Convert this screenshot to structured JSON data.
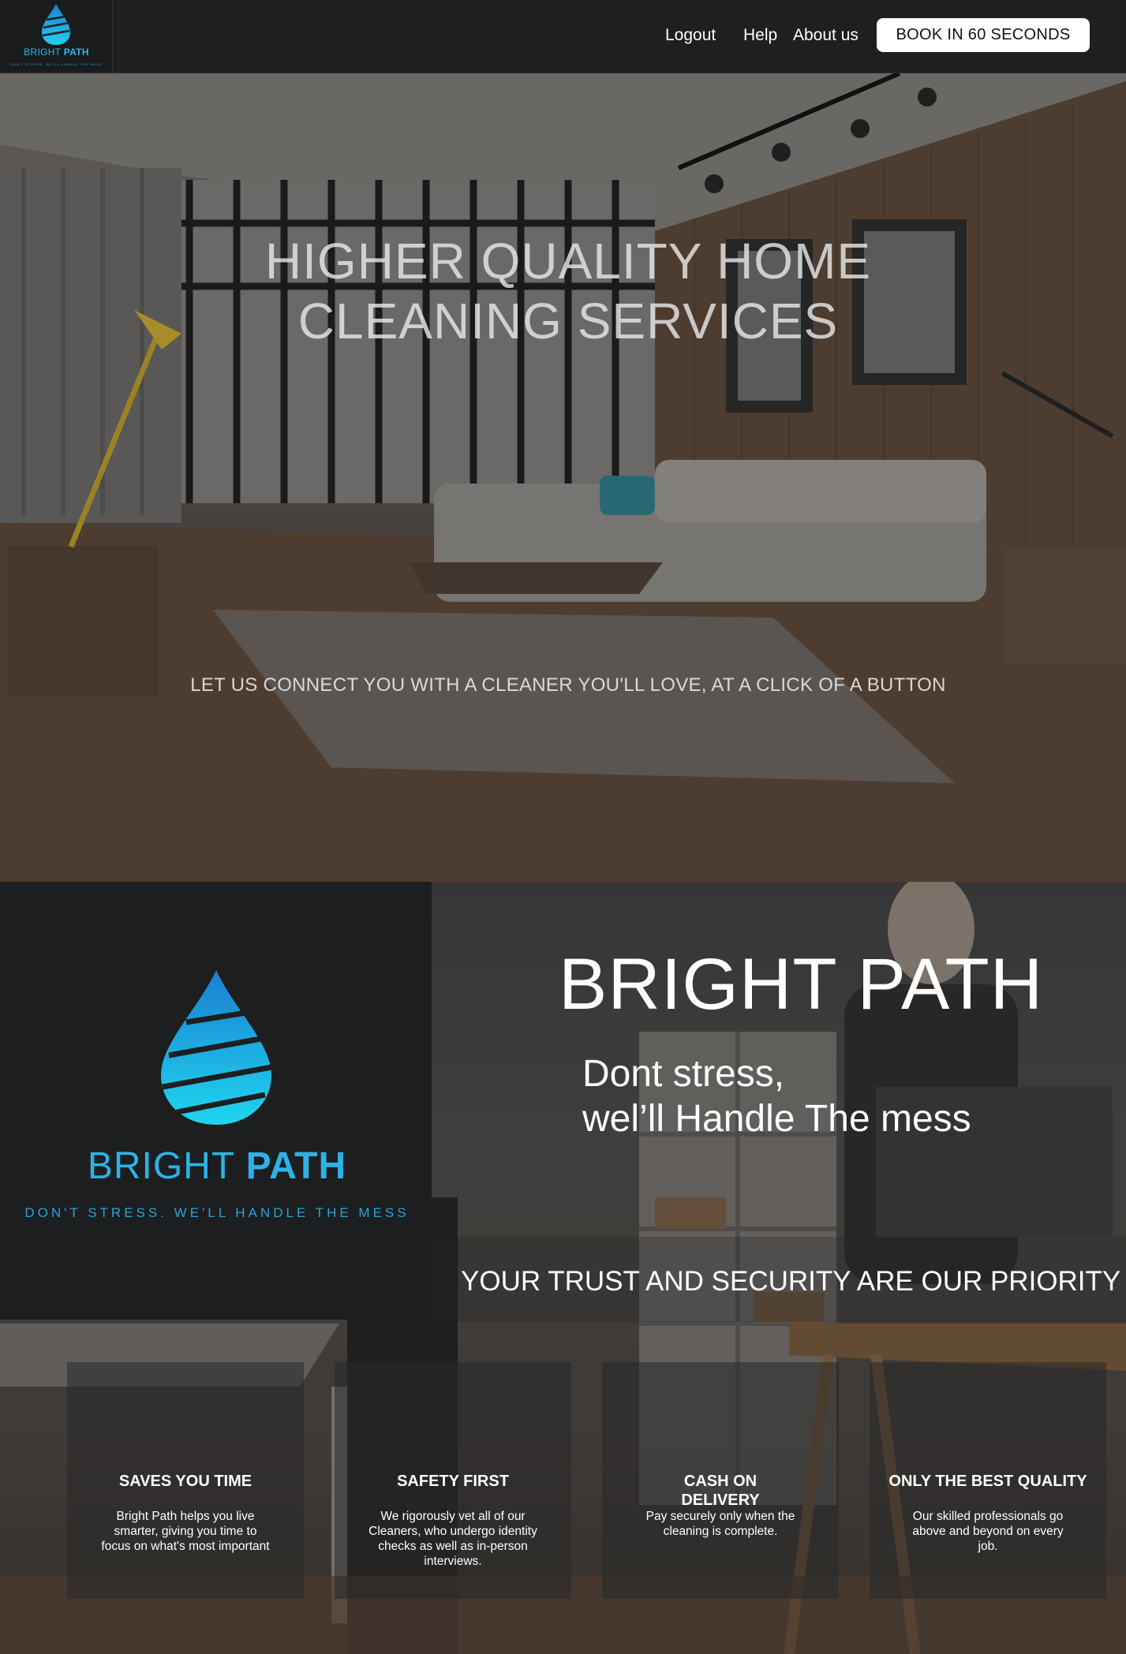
{
  "nav": {
    "logo": {
      "brand_light": "BRIGHT ",
      "brand_bold": "PATH",
      "tagline": "DON'T STRESS. WE'LL HANDLE THE MESS"
    },
    "links": [
      "Logout",
      "Help",
      "About us"
    ],
    "cta_label": "BOOK IN 60 SECONDS"
  },
  "hero": {
    "title_line1": "HIGHER QUALITY HOME",
    "title_line2": "CLEANING SERVICES",
    "subtitle": "LET US CONNECT YOU WITH A CLEANER YOU'LL LOVE, AT A CLICK OF A BUTTON"
  },
  "about": {
    "logo": {
      "brand_light": "BRIGHT ",
      "brand_bold": "PATH",
      "tagline": "DON'T STRESS. WE'LL HANDLE THE MESS"
    },
    "title": "BRIGHT PATH",
    "subtitle_line1": "Dont stress,",
    "subtitle_line2": "wel’ll Handle The mess",
    "trust_banner": "YOUR TRUST AND SECURITY ARE OUR PRIORITY"
  },
  "features": [
    {
      "title": "SAVES YOU TIME",
      "text": "Bright Path helps you live smarter, giving you time to focus on what's most important"
    },
    {
      "title": "SAFETY FIRST",
      "text": "We rigorously vet all of our Cleaners, who undergo identity checks as well as in-person interviews."
    },
    {
      "title": "CASH ON DELIVERY",
      "text": "Pay securely  only when the cleaning is complete."
    },
    {
      "title": "ONLY THE BEST QUALITY",
      "text": "Our skilled professionals go above and beyond on every job."
    }
  ],
  "colors": {
    "brand_blue": "#2cb3e6",
    "nav_bg": "#1e1f21",
    "panel_bg": "#1d1e20"
  }
}
